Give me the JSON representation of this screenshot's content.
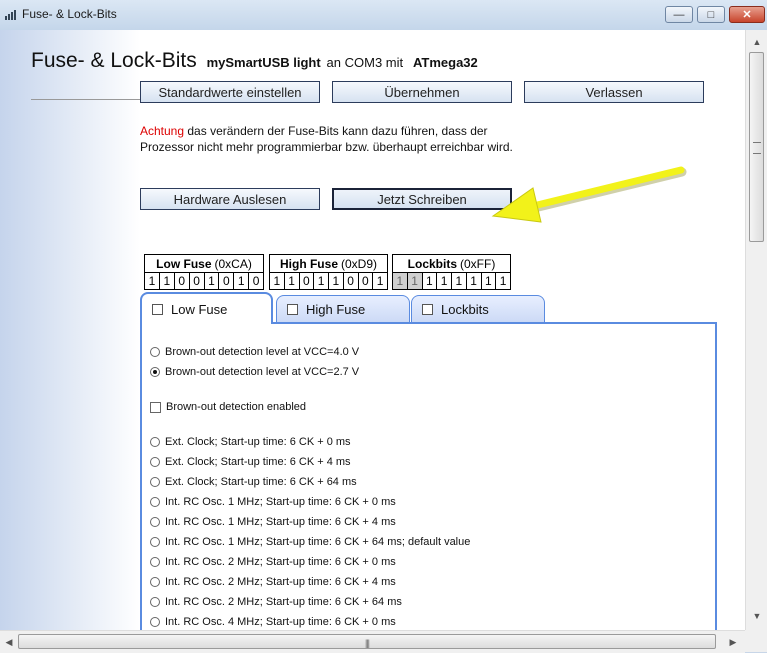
{
  "window": {
    "title": "Fuse- & Lock-Bits"
  },
  "header": {
    "title": "Fuse- & Lock-Bits",
    "device_bold": "mySmartUSB light",
    "port_text": "an COM3 mit",
    "chip_bold": "ATmega32"
  },
  "buttons": {
    "defaults": "Standardwerte einstellen",
    "apply": "Übernehmen",
    "exit": "Verlassen",
    "read": "Hardware Auslesen",
    "write": "Jetzt Schreiben"
  },
  "warning": {
    "highlight": "Achtung",
    "text": " das verändern der Fuse-Bits kann dazu führen, dass der Prozessor nicht mehr programmierbar bzw. überhaupt erreichbar wird."
  },
  "fuses": {
    "low": {
      "label": "Low Fuse",
      "hex": "(0xCA)",
      "bits": [
        "1",
        "1",
        "0",
        "0",
        "1",
        "0",
        "1",
        "0"
      ]
    },
    "high": {
      "label": "High Fuse",
      "hex": "(0xD9)",
      "bits": [
        "1",
        "1",
        "0",
        "1",
        "1",
        "0",
        "0",
        "1"
      ]
    },
    "lock": {
      "label": "Lockbits",
      "hex": "(0xFF)",
      "bits": [
        "1",
        "1",
        "1",
        "1",
        "1",
        "1",
        "1",
        "1"
      ]
    }
  },
  "tabs": [
    {
      "label": "Low Fuse",
      "active": true
    },
    {
      "label": "High Fuse",
      "active": false
    },
    {
      "label": "Lockbits",
      "active": false
    }
  ],
  "options": {
    "bod_level_4v": "Brown-out detection level at VCC=4.0 V",
    "bod_level_27v": "Brown-out detection level at VCC=2.7 V",
    "bod_enabled": "Brown-out detection enabled",
    "clk1": "Ext. Clock; Start-up time: 6 CK + 0 ms",
    "clk2": "Ext. Clock; Start-up time: 6 CK + 4 ms",
    "clk3": "Ext. Clock; Start-up time: 6 CK + 64 ms",
    "clk4": "Int. RC Osc. 1 MHz; Start-up time: 6 CK + 0 ms",
    "clk5": "Int. RC Osc. 1 MHz; Start-up time: 6 CK + 4 ms",
    "clk6": "Int. RC Osc. 1 MHz; Start-up time: 6 CK + 64 ms; default value",
    "clk7": "Int. RC Osc. 2 MHz; Start-up time: 6 CK + 0 ms",
    "clk8": "Int. RC Osc. 2 MHz; Start-up time: 6 CK + 4 ms",
    "clk9": "Int. RC Osc. 2 MHz; Start-up time: 6 CK + 64 ms",
    "clk10": "Int. RC Osc. 4 MHz; Start-up time: 6 CK + 0 ms"
  },
  "colors": {
    "accent": "#5a8be0",
    "warning": "#dd0000",
    "arrow": "#f2f21a"
  }
}
